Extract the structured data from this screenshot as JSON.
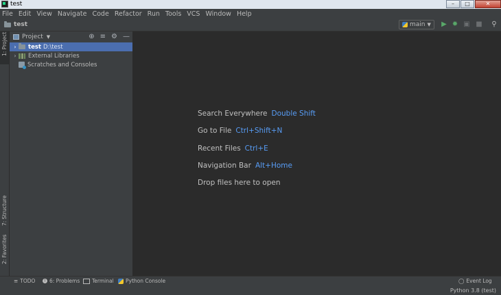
{
  "window": {
    "title": "test"
  },
  "menu": [
    "File",
    "Edit",
    "View",
    "Navigate",
    "Code",
    "Refactor",
    "Run",
    "Tools",
    "VCS",
    "Window",
    "Help"
  ],
  "breadcrumb": {
    "project": "test"
  },
  "run_config": {
    "name": "main"
  },
  "side_tabs": {
    "project": "1: Project",
    "structure": "7: Structure",
    "favorites": "2: Favorites"
  },
  "project_panel": {
    "title": "Project",
    "tree": [
      {
        "label": "test",
        "path": "D:\\test",
        "selected": true
      },
      {
        "label": "External Libraries"
      },
      {
        "label": "Scratches and Consoles"
      }
    ]
  },
  "editor_hints": [
    {
      "text": "Search Everywhere",
      "shortcut": "Double Shift"
    },
    {
      "text": "Go to File",
      "shortcut": "Ctrl+Shift+N"
    },
    {
      "text": "Recent Files",
      "shortcut": "Ctrl+E"
    },
    {
      "text": "Navigation Bar",
      "shortcut": "Alt+Home"
    },
    {
      "text": "Drop files here to open",
      "shortcut": ""
    }
  ],
  "tool_windows": {
    "todo": "TODO",
    "problems": "6: Problems",
    "terminal": "Terminal",
    "python_console": "Python Console",
    "event_log": "Event Log"
  },
  "status": {
    "interpreter": "Python 3.8 (test)"
  },
  "colors": {
    "background": "#2b2b2b",
    "panel": "#3c3f41",
    "selection": "#4b6eaf",
    "shortcut": "#589df6",
    "run": "#59a869"
  }
}
